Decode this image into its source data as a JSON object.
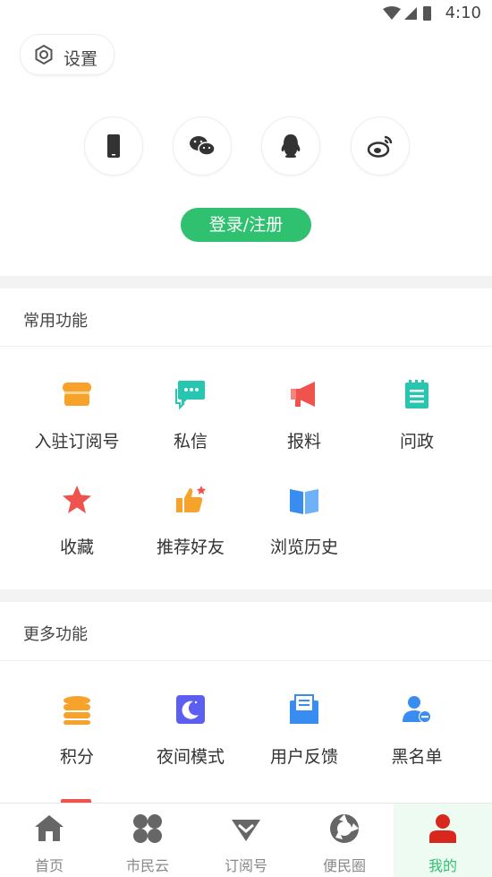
{
  "status_bar": {
    "time": "4:10"
  },
  "settings": {
    "label": "设置"
  },
  "login": {
    "label": "登录/注册"
  },
  "common": {
    "title": "常用功能",
    "items": [
      {
        "label": "入驻订阅号",
        "icon": "shop-icon"
      },
      {
        "label": "私信",
        "icon": "message-icon"
      },
      {
        "label": "报料",
        "icon": "megaphone-icon"
      },
      {
        "label": "问政",
        "icon": "notepad-icon"
      },
      {
        "label": "收藏",
        "icon": "star-icon"
      },
      {
        "label": "推荐好友",
        "icon": "thumbs-up-icon"
      },
      {
        "label": "浏览历史",
        "icon": "book-icon"
      }
    ]
  },
  "more": {
    "title": "更多功能",
    "items": [
      {
        "label": "积分",
        "icon": "coins-icon"
      },
      {
        "label": "夜间模式",
        "icon": "moon-icon"
      },
      {
        "label": "用户反馈",
        "icon": "envelope-icon"
      },
      {
        "label": "黑名单",
        "icon": "user-block-icon"
      }
    ]
  },
  "tabs": [
    {
      "label": "首页",
      "icon": "home-icon"
    },
    {
      "label": "市民云",
      "icon": "cloud-grid-icon"
    },
    {
      "label": "订阅号",
      "icon": "subscribe-icon"
    },
    {
      "label": "便民圈",
      "icon": "circle-icon"
    },
    {
      "label": "我的",
      "icon": "person-icon"
    }
  ],
  "colors": {
    "accent": "#2fc170",
    "orange": "#f7a32b",
    "teal": "#26c6b0",
    "red": "#f0524d",
    "blue": "#3a8df0",
    "active_tab_icon": "#d8271c"
  }
}
